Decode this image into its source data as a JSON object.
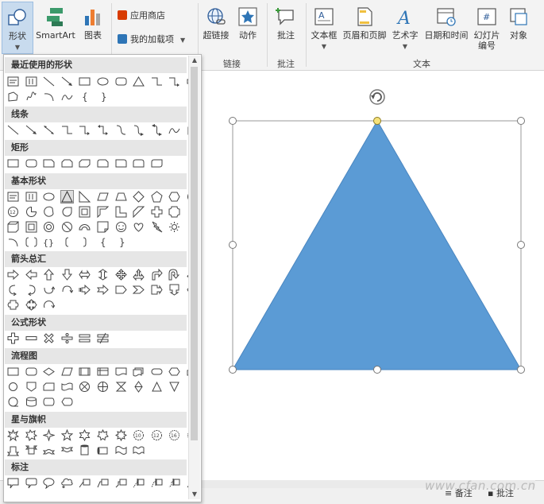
{
  "ribbon": {
    "shapes_label": "形状",
    "smartart_label": "SmartArt",
    "chart_label": "图表",
    "store_label": "应用商店",
    "addins_label": "我的加载项",
    "hyperlink_label": "超链接",
    "action_label": "动作",
    "comment_label": "批注",
    "textbox_label": "文本框",
    "header_footer_label": "页眉和页脚",
    "wordart_label": "艺术字",
    "datetime_label": "日期和时间",
    "slide_number_label_1": "幻灯片",
    "slide_number_label_2": "编号",
    "object_label": "对象",
    "group_links": "链接",
    "group_comments": "批注",
    "group_text": "文本"
  },
  "gallery": {
    "categories": {
      "recent": "最近使用的形状",
      "lines": "线条",
      "rectangles": "矩形",
      "basic": "基本形状",
      "arrows": "箭头总汇",
      "equation": "公式形状",
      "flowchart": "流程图",
      "stars": "星与旗帜",
      "callouts": "标注"
    },
    "selected_shape": "isosceles-triangle"
  },
  "slide": {
    "shape": "isosceles-triangle",
    "fill_color": "#5b9bd5",
    "selected": true
  },
  "status": {
    "notes_label": "备注",
    "comments_label": "批注"
  },
  "watermark": "www.cfan.com.cn",
  "colors": {
    "accent": "#5b9bd5",
    "ribbon_bg": "#f3f3f3",
    "selected_button": "#c8dbee"
  }
}
